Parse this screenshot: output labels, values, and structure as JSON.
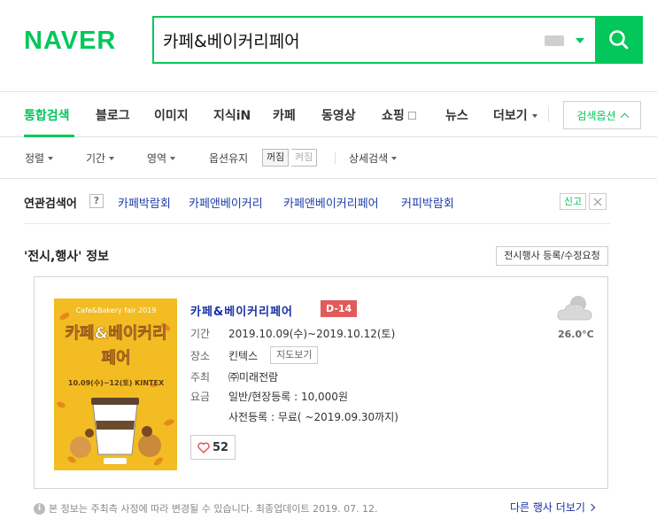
{
  "brand": {
    "logo": "NAVER",
    "color": "#03c75a"
  },
  "search": {
    "query": "카페&베이커리페어"
  },
  "tabs": [
    {
      "label": "통합검색",
      "active": true
    },
    {
      "label": "블로그"
    },
    {
      "label": "이미지"
    },
    {
      "label": "지식iN"
    },
    {
      "label": "카페"
    },
    {
      "label": "동영상"
    },
    {
      "label": "쇼핑"
    },
    {
      "label": "뉴스"
    },
    {
      "label": "더보기"
    }
  ],
  "search_options_label": "검색옵션",
  "filters": {
    "sort": "정렬",
    "period": "기간",
    "area": "영역",
    "keep_options": "옵션유지",
    "toggle_off": "꺼짐",
    "toggle_on": "켜짐",
    "advanced": "상세검색"
  },
  "related": {
    "title": "연관검색어",
    "help": "?",
    "links": [
      "카페박람회",
      "카페앤베이커리",
      "카페앤베이커리페어",
      "커피박람회"
    ],
    "report": "신고"
  },
  "section": {
    "title": "'전시,행사' 정보",
    "request_btn": "전시행사 등록/수정요청"
  },
  "event": {
    "title": "카페&베이커리페어",
    "dday": "D-14",
    "period_label": "기간",
    "period": "2019.10.09(수)~2019.10.12(토)",
    "venue_label": "장소",
    "venue": "킨텍스",
    "map_btn": "지도보기",
    "host_label": "주최",
    "host": "㈜미래전람",
    "fee_label": "요금",
    "fee_1": "일반/현장등록 : 10,000원",
    "fee_2": "사전등록 : 무료( ~2019.09.30까지)",
    "likes": "52",
    "weather_icon": "cloud-icon",
    "temperature": "26.0°C",
    "poster": {
      "top_label": "Cafe&Bakery fair 2019",
      "title_1": "카페&베이커리",
      "title_2": "페어",
      "dates": "10.09(수)~12(토) KINTEX"
    }
  },
  "footer": {
    "note": "본 정보는 주최측 사정에 따라 변경될 수 있습니다. 최종업데이트 2019. 07. 12.",
    "more_events": "다른 행사 더보기"
  }
}
